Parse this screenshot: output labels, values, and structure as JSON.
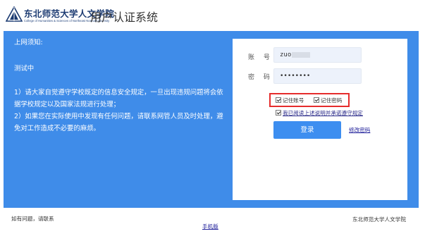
{
  "header": {
    "brand_cn": "东北师范大学人文学院",
    "brand_en": "College of Humanities & Sciences of Northeast Normal University",
    "system_title": "用户认证系统"
  },
  "notice": {
    "heading": "上网须知:",
    "test_text": "测试中",
    "rule1": "1）请大家自觉遵守学校既定的信息安全规定，一旦出现违规问题将会依据学校规定以及国家法规进行处理；",
    "rule2": "2）如果您在实际使用中发现有任何问题，请联系网管人员及时处理，避免对工作造成不必要的麻烦。"
  },
  "login": {
    "account_label": "账 号",
    "account_value": "zuo",
    "password_label": "密 码",
    "password_value": "••••••••",
    "remember_account": "记住账号",
    "remember_password": "记住密码",
    "agreement": "我已阅读上述说明并承诺遵守规定",
    "login_button": "登录",
    "change_password": "修改密码"
  },
  "footer": {
    "contact": "如有问题，请联系",
    "mobile_link": "手机版",
    "org": "东北师范大学人文学院"
  },
  "colors": {
    "band": "#3f8ce9",
    "button": "#3d8ef0",
    "highlight_box": "#e52c2c"
  },
  "icons": {
    "logo": "mountain-logo-icon",
    "checkbox": "checkmark-icon"
  }
}
